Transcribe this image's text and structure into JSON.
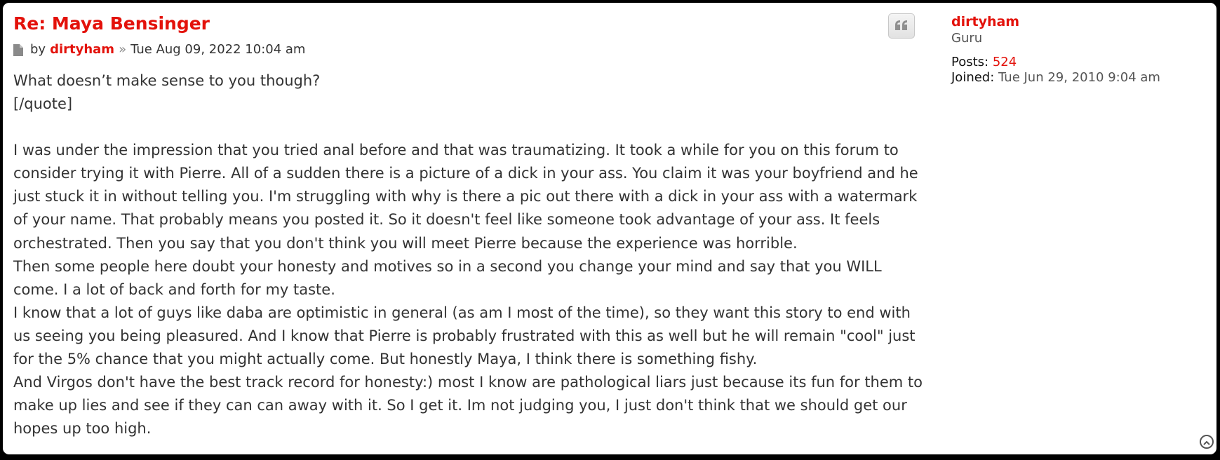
{
  "post": {
    "title": "Re: Maya Bensinger",
    "by_label": "by",
    "author": "dirtyham",
    "separator": "»",
    "date": "Tue Aug 09, 2022 10:04 am",
    "paragraphs": [
      "What doesn’t make sense to you though?",
      "[/quote]",
      "",
      "I was under the impression that you tried anal before and that was traumatizing. It took a while for you on this forum to consider trying it with Pierre. All of a sudden there is a picture of a dick in your ass. You claim it was your boyfriend and he just stuck it in without telling you. I'm struggling with why is there a pic out there with a dick in your ass with a watermark of your name. That probably means you posted it. So it doesn't feel like someone took advantage of your ass. It feels orchestrated. Then you say that you don't think you will meet Pierre because the experience was horrible.",
      "Then some people here doubt your honesty and motives so in a second you change your mind and say that you WILL come. I a lot of back and forth for my taste.",
      "I know that a lot of guys like daba are optimistic in general (as am I most of the time), so they want this story to end with us seeing you being pleasured. And I know that Pierre is probably frustrated with this as well but he will remain \"cool\" just for the 5% chance that you might actually come. But honestly Maya, I think there is something fishy.",
      "And Virgos don't have the best track record for honesty:) most I know are pathological liars just because its fun for them to make up lies and see if they can can away with it. So I get it. Im not judging you, I just don't think that we should get our hopes up too high."
    ]
  },
  "profile": {
    "username": "dirtyham",
    "rank": "Guru",
    "posts_label": "Posts:",
    "posts_value": "524",
    "joined_label": "Joined:",
    "joined_value": "Tue Jun 29, 2010 9:04 am"
  },
  "icons": {
    "post": "post-file-icon",
    "quote": "quote-icon",
    "top": "back-to-top-icon"
  },
  "colors": {
    "accent": "#e3120b",
    "text": "#333333"
  }
}
